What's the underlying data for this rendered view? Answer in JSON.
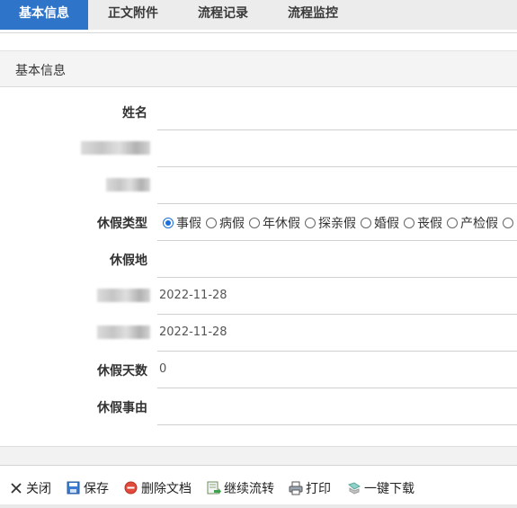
{
  "tabs": [
    {
      "label": "基本信息",
      "active": true
    },
    {
      "label": "正文附件"
    },
    {
      "label": "流程记录"
    },
    {
      "label": "流程监控"
    }
  ],
  "section": {
    "title": "基本信息"
  },
  "form": {
    "name_label": "姓名",
    "leave_type_label": "休假类型",
    "leave_type_options": [
      "事假",
      "病假",
      "年休假",
      "探亲假",
      "婚假",
      "丧假",
      "产检假"
    ],
    "leave_type_selected": "事假",
    "location_label": "休假地",
    "start_date_value": "2022-11-28",
    "end_date_value": "2022-11-28",
    "days_label": "休假天数",
    "days_value": "0",
    "reason_label": "休假事由"
  },
  "toolbar": {
    "close_label": "关闭",
    "save_label": "保存",
    "delete_label": "删除文档",
    "continue_label": "继续流转",
    "print_label": "打印",
    "download_label": "一键下载"
  },
  "colors": {
    "accent": "#2e74c8",
    "radio_selected": "#1a6fd8"
  }
}
